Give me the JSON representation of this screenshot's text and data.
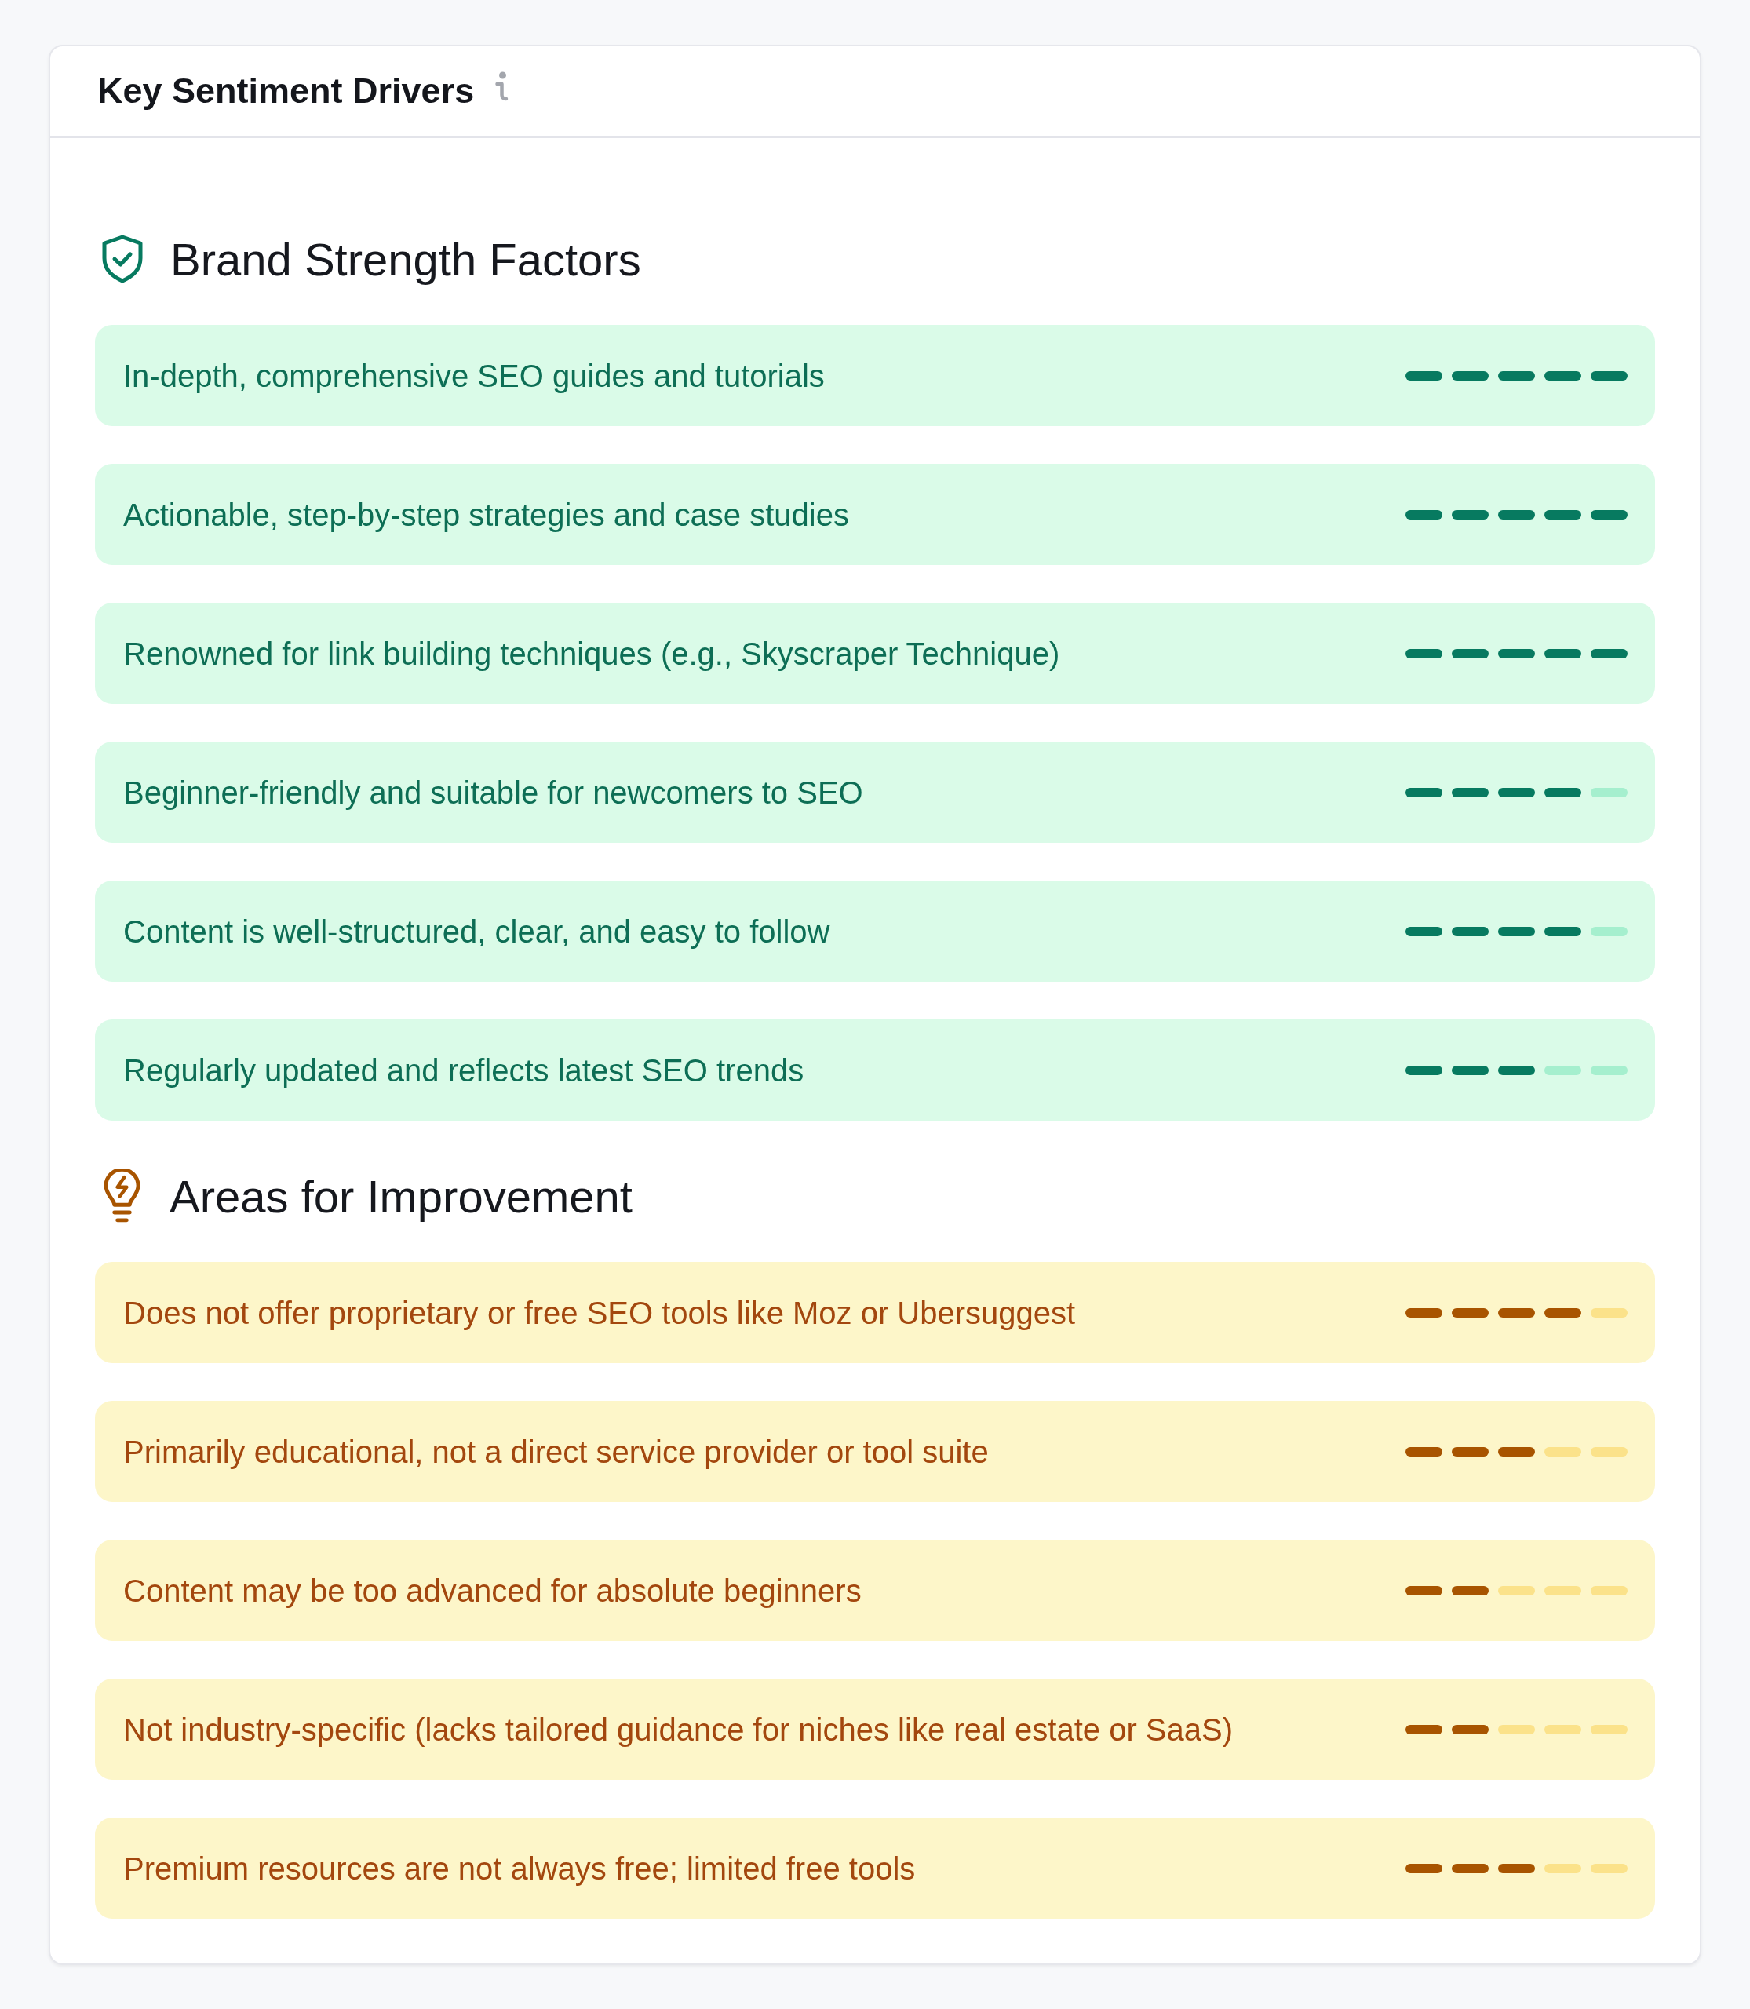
{
  "card": {
    "title": "Key Sentiment Drivers"
  },
  "sections": [
    {
      "kind": "strength",
      "heading": "Brand Strength Factors",
      "items": [
        {
          "text": "In-depth, comprehensive SEO guides and tutorials",
          "level": 1
        },
        {
          "text": "Actionable, step-by-step strategies and case studies",
          "level": 1
        },
        {
          "text": "Renowned for link building techniques (e.g., Skyscraper Technique)",
          "level": 1
        },
        {
          "text": "Beginner-friendly and suitable for newcomers to SEO",
          "level": 0.8
        },
        {
          "text": "Content is well-structured, clear, and easy to follow",
          "level": 0.8
        },
        {
          "text": "Regularly updated and reflects latest SEO trends",
          "level": 0.6
        }
      ]
    },
    {
      "kind": "improvement",
      "heading": "Areas for Improvement",
      "items": [
        {
          "text": "Does not offer proprietary or free SEO tools like Moz or Ubersuggest",
          "level": 0.8
        },
        {
          "text": "Primarily educational, not a direct service provider or tool suite",
          "level": 0.6
        },
        {
          "text": "Content may be too advanced for absolute beginners",
          "level": 0.4
        },
        {
          "text": "Not industry-specific (lacks tailored guidance for niches like real estate or SaaS)",
          "level": 0.4
        },
        {
          "text": "Premium resources are not always free; limited free tools",
          "level": 0.6
        }
      ]
    }
  ]
}
